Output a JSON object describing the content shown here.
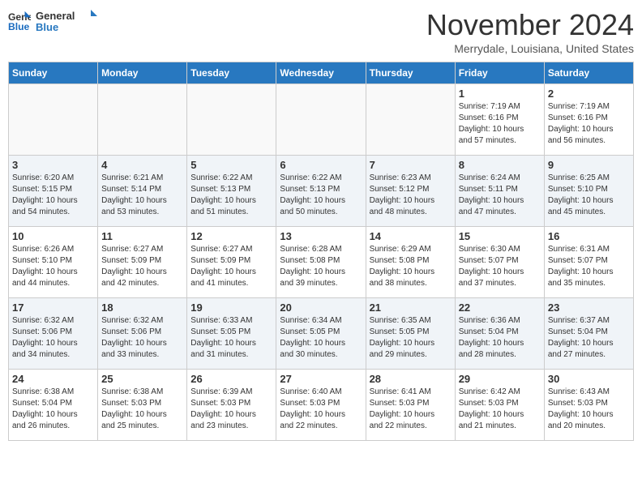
{
  "header": {
    "logo_line1": "General",
    "logo_line2": "Blue",
    "month": "November 2024",
    "location": "Merrydale, Louisiana, United States"
  },
  "weekdays": [
    "Sunday",
    "Monday",
    "Tuesday",
    "Wednesday",
    "Thursday",
    "Friday",
    "Saturday"
  ],
  "weeks": [
    [
      {
        "day": "",
        "info": ""
      },
      {
        "day": "",
        "info": ""
      },
      {
        "day": "",
        "info": ""
      },
      {
        "day": "",
        "info": ""
      },
      {
        "day": "",
        "info": ""
      },
      {
        "day": "1",
        "info": "Sunrise: 7:19 AM\nSunset: 6:16 PM\nDaylight: 10 hours\nand 57 minutes."
      },
      {
        "day": "2",
        "info": "Sunrise: 7:19 AM\nSunset: 6:16 PM\nDaylight: 10 hours\nand 56 minutes."
      }
    ],
    [
      {
        "day": "3",
        "info": "Sunrise: 6:20 AM\nSunset: 5:15 PM\nDaylight: 10 hours\nand 54 minutes."
      },
      {
        "day": "4",
        "info": "Sunrise: 6:21 AM\nSunset: 5:14 PM\nDaylight: 10 hours\nand 53 minutes."
      },
      {
        "day": "5",
        "info": "Sunrise: 6:22 AM\nSunset: 5:13 PM\nDaylight: 10 hours\nand 51 minutes."
      },
      {
        "day": "6",
        "info": "Sunrise: 6:22 AM\nSunset: 5:13 PM\nDaylight: 10 hours\nand 50 minutes."
      },
      {
        "day": "7",
        "info": "Sunrise: 6:23 AM\nSunset: 5:12 PM\nDaylight: 10 hours\nand 48 minutes."
      },
      {
        "day": "8",
        "info": "Sunrise: 6:24 AM\nSunset: 5:11 PM\nDaylight: 10 hours\nand 47 minutes."
      },
      {
        "day": "9",
        "info": "Sunrise: 6:25 AM\nSunset: 5:10 PM\nDaylight: 10 hours\nand 45 minutes."
      }
    ],
    [
      {
        "day": "10",
        "info": "Sunrise: 6:26 AM\nSunset: 5:10 PM\nDaylight: 10 hours\nand 44 minutes."
      },
      {
        "day": "11",
        "info": "Sunrise: 6:27 AM\nSunset: 5:09 PM\nDaylight: 10 hours\nand 42 minutes."
      },
      {
        "day": "12",
        "info": "Sunrise: 6:27 AM\nSunset: 5:09 PM\nDaylight: 10 hours\nand 41 minutes."
      },
      {
        "day": "13",
        "info": "Sunrise: 6:28 AM\nSunset: 5:08 PM\nDaylight: 10 hours\nand 39 minutes."
      },
      {
        "day": "14",
        "info": "Sunrise: 6:29 AM\nSunset: 5:08 PM\nDaylight: 10 hours\nand 38 minutes."
      },
      {
        "day": "15",
        "info": "Sunrise: 6:30 AM\nSunset: 5:07 PM\nDaylight: 10 hours\nand 37 minutes."
      },
      {
        "day": "16",
        "info": "Sunrise: 6:31 AM\nSunset: 5:07 PM\nDaylight: 10 hours\nand 35 minutes."
      }
    ],
    [
      {
        "day": "17",
        "info": "Sunrise: 6:32 AM\nSunset: 5:06 PM\nDaylight: 10 hours\nand 34 minutes."
      },
      {
        "day": "18",
        "info": "Sunrise: 6:32 AM\nSunset: 5:06 PM\nDaylight: 10 hours\nand 33 minutes."
      },
      {
        "day": "19",
        "info": "Sunrise: 6:33 AM\nSunset: 5:05 PM\nDaylight: 10 hours\nand 31 minutes."
      },
      {
        "day": "20",
        "info": "Sunrise: 6:34 AM\nSunset: 5:05 PM\nDaylight: 10 hours\nand 30 minutes."
      },
      {
        "day": "21",
        "info": "Sunrise: 6:35 AM\nSunset: 5:05 PM\nDaylight: 10 hours\nand 29 minutes."
      },
      {
        "day": "22",
        "info": "Sunrise: 6:36 AM\nSunset: 5:04 PM\nDaylight: 10 hours\nand 28 minutes."
      },
      {
        "day": "23",
        "info": "Sunrise: 6:37 AM\nSunset: 5:04 PM\nDaylight: 10 hours\nand 27 minutes."
      }
    ],
    [
      {
        "day": "24",
        "info": "Sunrise: 6:38 AM\nSunset: 5:04 PM\nDaylight: 10 hours\nand 26 minutes."
      },
      {
        "day": "25",
        "info": "Sunrise: 6:38 AM\nSunset: 5:03 PM\nDaylight: 10 hours\nand 25 minutes."
      },
      {
        "day": "26",
        "info": "Sunrise: 6:39 AM\nSunset: 5:03 PM\nDaylight: 10 hours\nand 23 minutes."
      },
      {
        "day": "27",
        "info": "Sunrise: 6:40 AM\nSunset: 5:03 PM\nDaylight: 10 hours\nand 22 minutes."
      },
      {
        "day": "28",
        "info": "Sunrise: 6:41 AM\nSunset: 5:03 PM\nDaylight: 10 hours\nand 22 minutes."
      },
      {
        "day": "29",
        "info": "Sunrise: 6:42 AM\nSunset: 5:03 PM\nDaylight: 10 hours\nand 21 minutes."
      },
      {
        "day": "30",
        "info": "Sunrise: 6:43 AM\nSunset: 5:03 PM\nDaylight: 10 hours\nand 20 minutes."
      }
    ]
  ]
}
